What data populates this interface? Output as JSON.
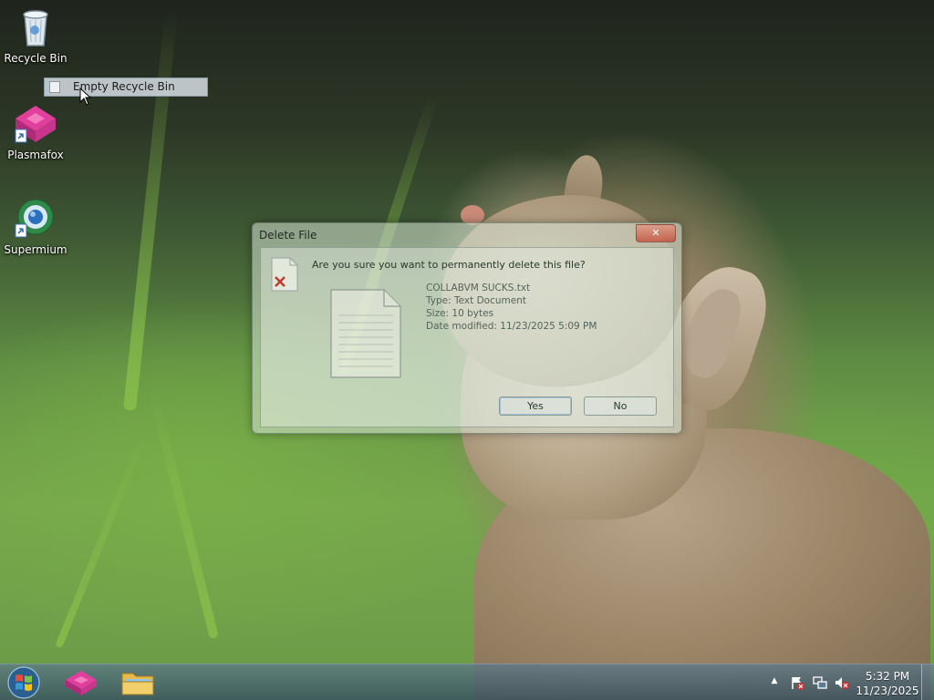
{
  "desktop": {
    "icons": [
      {
        "label": "Recycle Bin",
        "icon": "recycle-bin-icon"
      },
      {
        "label": "Plasmafox",
        "icon": "plasmafox-icon"
      },
      {
        "label": "Supermium",
        "icon": "supermium-icon"
      }
    ]
  },
  "context_menu": {
    "item_label": "Empty Recycle Bin"
  },
  "dialog": {
    "title": "Delete File",
    "close_label": "✕",
    "question": "Are you sure you want to permanently delete this file?",
    "file_name": "COLLABVM SUCKS.txt",
    "file_type": "Type: Text Document",
    "file_size": "Size: 10 bytes",
    "file_modified": "Date modified: 11/23/2025 5:09 PM",
    "yes_label": "Yes",
    "no_label": "No"
  },
  "taskbar": {
    "start_icon": "windows-orb-icon",
    "pinned": [
      {
        "name": "Plasmafox",
        "icon": "plasmafox-icon"
      },
      {
        "name": "Windows Explorer",
        "icon": "folder-icon"
      }
    ],
    "tray_arrow": "▲",
    "clock_time": "5:32 PM",
    "clock_date": "11/23/2025"
  },
  "colors": {
    "plasmafox_magenta": "#e0409c",
    "taskbar": "#4a6b80",
    "dialog_glass": "#d6e2d4"
  }
}
